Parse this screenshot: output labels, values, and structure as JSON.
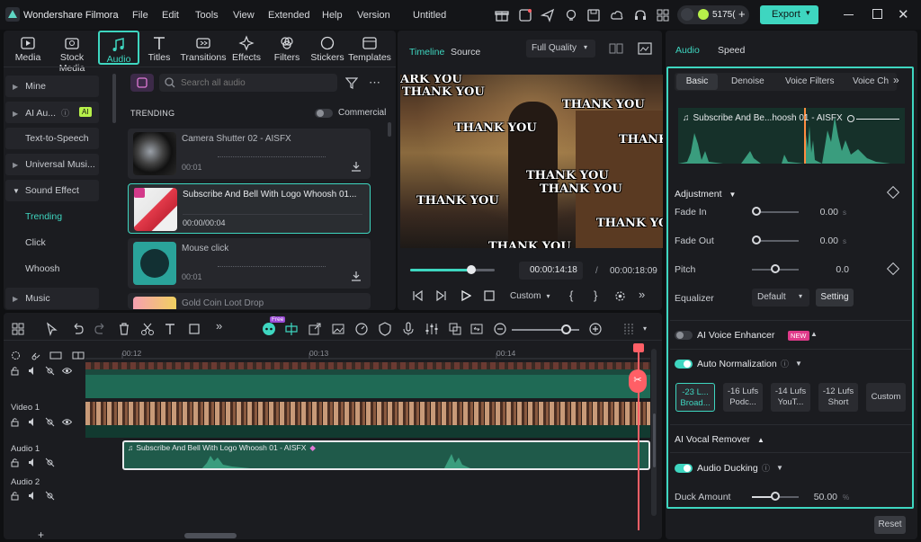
{
  "app": {
    "title": "Wondershare Filmora",
    "project": "Untitled",
    "credits": "5175(",
    "export_label": "Export"
  },
  "menu": [
    "File",
    "Edit",
    "Tools",
    "View",
    "Extended",
    "Help",
    "Version"
  ],
  "media_tabs": [
    "Media",
    "Stock Media",
    "Audio",
    "Titles",
    "Transitions",
    "Effects",
    "Filters",
    "Stickers",
    "Templates"
  ],
  "sidebar": {
    "mine": "Mine",
    "ai_audio": "AI Au...",
    "ai_badge": "AI",
    "tts": "Text-to-Speech",
    "universal": "Universal Musi...",
    "sound_effect": "Sound Effect",
    "trending": "Trending",
    "click": "Click",
    "whoosh": "Whoosh",
    "music": "Music"
  },
  "search": {
    "placeholder": "Search all audio"
  },
  "trending_label": "TRENDING",
  "commercial_label": "Commercial",
  "audio_items": [
    {
      "title": "Camera Shutter 02 - AISFX",
      "duration": "00:01"
    },
    {
      "title": "Subscribe And Bell With Logo Whoosh 01...",
      "duration": "00:00/00:04"
    },
    {
      "title": "Mouse click",
      "duration": "00:01"
    },
    {
      "title": "Gold Coin Loot Drop",
      "duration": ""
    }
  ],
  "preview": {
    "tab_timeline": "Timeline",
    "tab_source": "Source",
    "quality": "Full Quality",
    "current_time": "00:00:14:18",
    "separator": "/",
    "total_time": "00:00:18:09",
    "custom_label": "Custom",
    "progress": 0.72,
    "overlay_texts": [
      "ARK YOU",
      "THANK YOU",
      "THANK YOU",
      "THANK YOU",
      "THANK",
      "THANK YOU",
      "THANK YOU",
      "THANK YOU",
      "THANK YOU",
      "THANK YOU"
    ]
  },
  "props": {
    "tab_audio": "Audio",
    "tab_speed": "Speed",
    "sub_basic": "Basic",
    "sub_denoise": "Denoise",
    "sub_voice_filters": "Voice Filters",
    "sub_voice_ch": "Voice Ch",
    "clip_name": "Subscribe And Be...hoosh 01 - AISFX",
    "adjustment": "Adjustment",
    "fade_in": "Fade In",
    "fade_in_val": "0.00",
    "fade_out": "Fade Out",
    "fade_out_val": "0.00",
    "sec": "s",
    "pitch": "Pitch",
    "pitch_val": "0.0",
    "equalizer": "Equalizer",
    "eq_value": "Default",
    "setting": "Setting",
    "ai_voice": "AI Voice Enhancer",
    "new_badge": "NEW",
    "auto_norm": "Auto Normalization",
    "presets": [
      {
        "top": "-23 L...",
        "bottom": "Broad..."
      },
      {
        "top": "-16 Lufs",
        "bottom": "Podc..."
      },
      {
        "top": "-14 Lufs",
        "bottom": "YouT..."
      },
      {
        "top": "-12 Lufs",
        "bottom": "Short"
      }
    ],
    "custom": "Custom",
    "vocal_remover": "AI Vocal Remover",
    "ducking": "Audio Ducking",
    "duck_amount": "Duck Amount",
    "duck_val": "50.00",
    "percent": "%",
    "reset": "Reset"
  },
  "timeline": {
    "ruler": [
      "00:12",
      "00:13",
      "00:14"
    ],
    "video1": "Video 1",
    "audio1": "Audio 1",
    "audio2": "Audio 2",
    "audio_clip": "Subscribe And Bell With Logo Whoosh 01 - AISFX",
    "free_badge": "Free"
  },
  "colors": {
    "accent": "#3ed6c0",
    "track_green": "#1f6a55",
    "playhead": "#ff5f66"
  }
}
